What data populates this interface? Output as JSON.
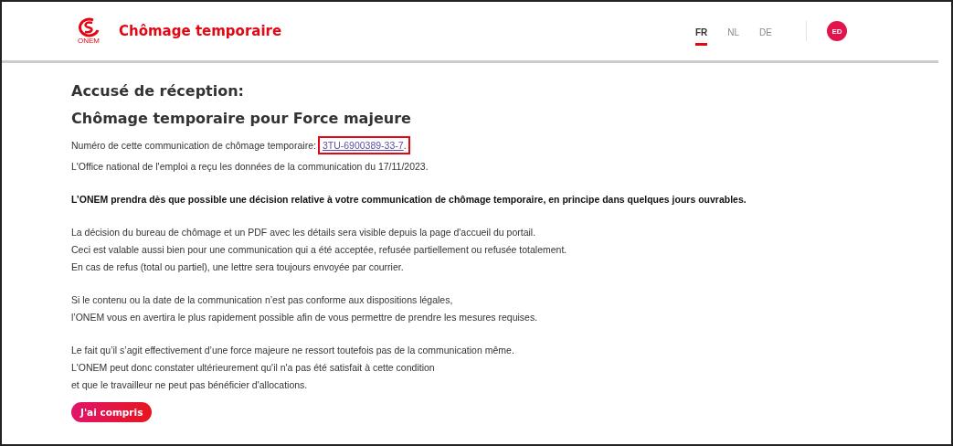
{
  "header": {
    "logo_text": "ONEM",
    "app_title": "Chômage temporaire",
    "languages": [
      {
        "label": "FR",
        "selected": true
      },
      {
        "label": "NL",
        "selected": false
      },
      {
        "label": "DE",
        "selected": false
      }
    ],
    "user_initials": "ED"
  },
  "page": {
    "title_lines": [
      "Accusé de réception:",
      "Chômage temporaire pour Force majeure"
    ],
    "reference": {
      "label": "Numéro de cette communication de chômage temporaire:",
      "number": "3TU-6900389-33-7",
      "suffix": ".",
      "highlighted": true
    },
    "received_text": "L'Office national de l'emploi a reçu les données de la communication du 17/11/2023.",
    "notice": "L’ONEM prendra dès que possible une décision relative à votre communication de chômage temporaire, en principe dans quelques jours ouvrables.",
    "paragraphs": [
      [
        "La décision du bureau de chômage et un PDF avec les détails sera visible depuis la page d'accueil du portail.",
        "Ceci est valable aussi bien pour une communication qui a été acceptée, refusée partiellement ou refusée totalement.",
        "En cas de refus (total ou partiel), une lettre sera toujours envoyée par courrier."
      ],
      [
        "Si le contenu ou la date de la communication n’est pas conforme aux dispositions légales,",
        "l’ONEM vous en avertira le plus rapidement possible afin de vous permettre de prendre les mesures requises."
      ],
      [
        "Le fait qu’il s’agit effectivement d’une force majeure ne ressort toutefois pas de la communication même.",
        "L'ONEM peut donc constater ultérieurement qu'il n'a pas été satisfait à cette condition",
        "et que le travailleur ne peut pas bénéficier d'allocations."
      ]
    ],
    "button": "J'ai compris"
  }
}
